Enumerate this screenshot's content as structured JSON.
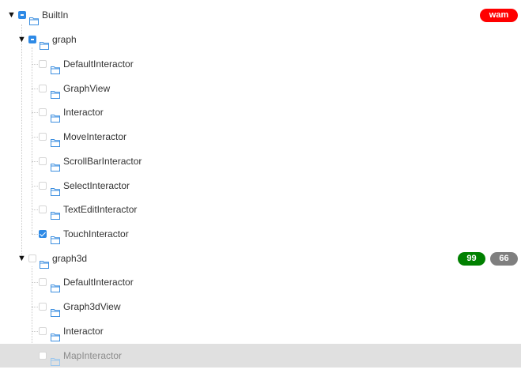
{
  "tree": {
    "root": {
      "label": "BuiltIn",
      "badge": {
        "text": "wam",
        "color": "#ff0000"
      },
      "expanded": true,
      "check": "indeterminate"
    },
    "groups": [
      {
        "label": "graph",
        "expanded": true,
        "check": "indeterminate",
        "children": [
          {
            "label": "DefaultInteractor",
            "checked": false
          },
          {
            "label": "GraphView",
            "checked": false
          },
          {
            "label": "Interactor",
            "checked": false
          },
          {
            "label": "MoveInteractor",
            "checked": false
          },
          {
            "label": "ScrollBarInteractor",
            "checked": false
          },
          {
            "label": "SelectInteractor",
            "checked": false
          },
          {
            "label": "TextEditInteractor",
            "checked": false
          },
          {
            "label": "TouchInteractor",
            "checked": true
          }
        ]
      },
      {
        "label": "graph3d",
        "expanded": true,
        "check": "unchecked",
        "badges": [
          {
            "text": "99",
            "color": "#008000"
          },
          {
            "text": "66",
            "color": "#7f7f7f"
          }
        ],
        "children": [
          {
            "label": "DefaultInteractor",
            "checked": false
          },
          {
            "label": "Graph3dView",
            "checked": false
          },
          {
            "label": "Interactor",
            "checked": false
          },
          {
            "label": "MapInteractor",
            "checked": false,
            "hovered": true
          }
        ]
      }
    ]
  },
  "icons": {
    "expanded": "triangle-down-icon",
    "node": "folder-icon"
  },
  "colors": {
    "accent": "#2e8ae6",
    "hover_row": "#e0e0e0",
    "connector": "#c8c8c8"
  }
}
